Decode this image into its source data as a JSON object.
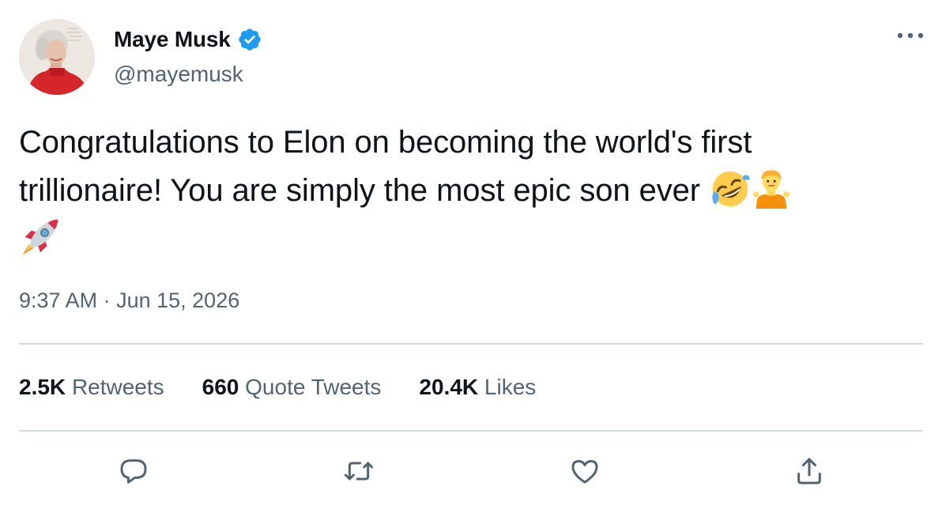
{
  "author": {
    "display_name": "Maye Musk",
    "handle": "@mayemusk",
    "verified": true,
    "avatar_icon": "profile-photo-woman-red-top"
  },
  "tweet": {
    "text_line1": "Congratulations to Elon on becoming the world's first",
    "text_line2": "trillionaire! You are simply the most epic son ever",
    "emojis": [
      "rolling-on-floor-laughing",
      "person-shrugging",
      "rocket"
    ],
    "time": "9:37 AM",
    "separator": "·",
    "date": "Jun 15, 2026"
  },
  "stats": {
    "retweets_count": "2.5K",
    "retweets_label": "Retweets",
    "quotes_count": "660",
    "quotes_label": "Quote Tweets",
    "likes_count": "20.4K",
    "likes_label": "Likes"
  },
  "actions": [
    "reply-icon",
    "retweet-icon",
    "like-icon",
    "share-icon"
  ],
  "colors": {
    "text_primary": "#0f1419",
    "text_secondary": "#536471",
    "divider": "#cfd9de",
    "verified": "#1d9bf0"
  }
}
